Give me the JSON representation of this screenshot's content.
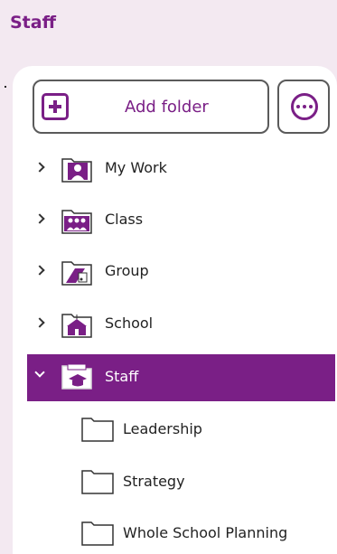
{
  "header": {
    "title": "Staff"
  },
  "toolbar": {
    "add_label": "Add folder"
  },
  "tree": {
    "items": [
      {
        "label": "My Work",
        "icon": "my-work-folder-icon",
        "expanded": false
      },
      {
        "label": "Class",
        "icon": "class-folder-icon",
        "expanded": false
      },
      {
        "label": "Group",
        "icon": "group-folder-icon",
        "expanded": false
      },
      {
        "label": "School",
        "icon": "school-folder-icon",
        "expanded": false
      },
      {
        "label": "Staff",
        "icon": "staff-folder-icon",
        "expanded": true,
        "selected": true
      }
    ],
    "children": [
      {
        "label": "Leadership",
        "icon": "folder-icon"
      },
      {
        "label": "Strategy",
        "icon": "folder-icon"
      },
      {
        "label": "Whole School Planning",
        "icon": "folder-icon"
      }
    ]
  },
  "colors": {
    "accent": "#7a1f86",
    "background": "#f3e9f1",
    "panel": "#ffffff"
  }
}
